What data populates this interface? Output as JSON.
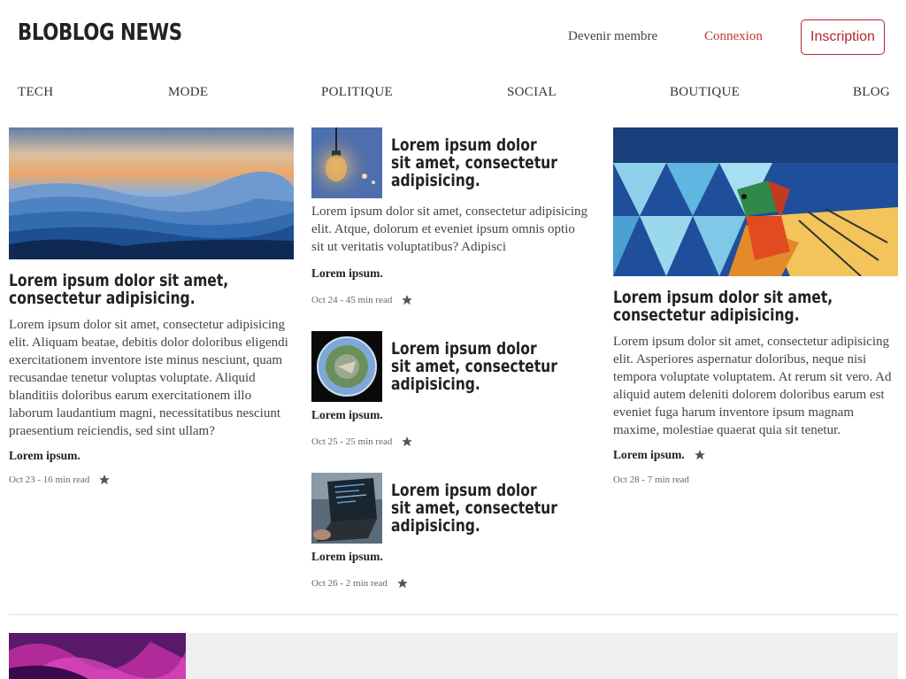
{
  "header": {
    "logo": "BLOBLOG NEWS",
    "member_link": "Devenir membre",
    "login_link": "Connexion",
    "signup_button": "Inscription"
  },
  "nav": {
    "items": [
      "TECH",
      "MODE",
      "POLITIQUE",
      "SOCIAL",
      "BOUTIQUE",
      "BLOG"
    ]
  },
  "left_card": {
    "title": "Lorem ipsum dolor sit amet, consectetur adipisicing.",
    "text": "Lorem ipsum dolor sit amet, consectetur adipisicing elit. Aliquam beatae, debitis dolor doloribus eligendi exercitationem inventore iste minus nesciunt, quam recusandae tenetur voluptas voluptate. Aliquid blanditiis doloribus earum exercitationem illo laborum laudantium magni, necessitatibus nesciunt praesentium reiciendis, sed sint ullam?",
    "author": "Lorem ipsum.",
    "meta": "Oct 23 - 16 min read",
    "image": "mountain-landscape"
  },
  "mid_cards": [
    {
      "title": "Lorem ipsum dolor sit amet, consectetur adipisicing.",
      "text": "Lorem ipsum dolor sit amet, consectetur adipisicing elit. Atque, dolorum et eveniet ipsum omnis optio sit ut veritatis voluptatibus? Adipisci",
      "author": "Lorem ipsum.",
      "meta": "Oct 24 - 45 min read",
      "image": "light-bulb"
    },
    {
      "title": "Lorem ipsum dolor sit amet, consectetur adipisicing.",
      "author": "Lorem ipsum.",
      "meta": "Oct 25 - 25 min read",
      "image": "tiny-planet"
    },
    {
      "title": "Lorem ipsum dolor sit amet, consectetur adipisicing.",
      "author": "Lorem ipsum.",
      "meta": "Oct 26 - 2 min read",
      "image": "laptop-code"
    }
  ],
  "right_card": {
    "title": "Lorem ipsum dolor sit amet, consectetur adipisicing.",
    "text": "Lorem ipsum dolor sit amet, consectetur adipisicing elit. Asperiores aspernatur doloribus, neque nisi tempora voluptate voluptatem. At rerum sit vero. Ad aliquid autem deleniti dolorem doloribus earum est eveniet fuga harum inventore ipsum magnam maxime, molestiae quaerat quia sit tenetur.",
    "author": "Lorem ipsum.",
    "meta": "Oct 28 - 7 min read",
    "image": "bird-mural"
  },
  "bottom": {
    "image": "abstract-purple"
  },
  "colors": {
    "accent": "#b3242b",
    "login": "#c0392b",
    "text": "#222222",
    "muted": "#666666",
    "panel": "#efefef"
  }
}
